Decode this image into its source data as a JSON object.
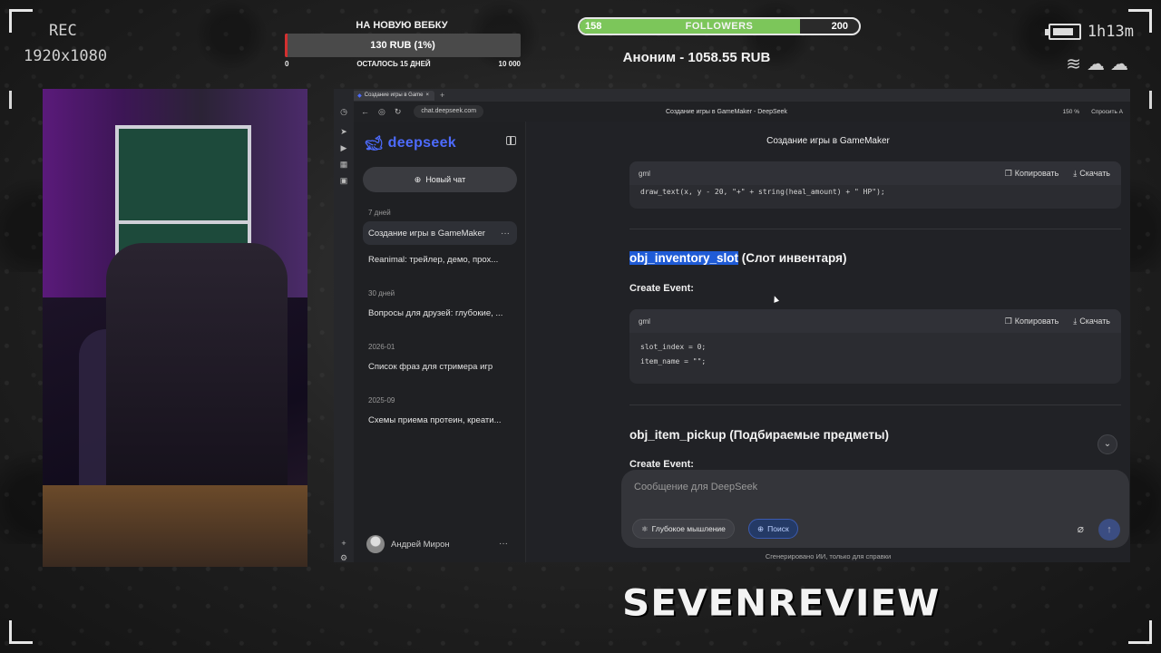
{
  "overlay": {
    "rec": "REC",
    "resolution": "1920x1080",
    "timer": "1h13m",
    "goal": {
      "title": "НА НОВУЮ ВЕБКУ",
      "amount": "130 RUB (1%)",
      "progress_fraction": 0.013,
      "min": "0",
      "remaining": "ОСТАЛОСЬ 15 ДНЕЙ",
      "max": "10 000"
    },
    "followers": {
      "current": "158",
      "label": "FOLLOWERS",
      "target": "200",
      "progress_fraction": 0.79
    },
    "donor": "Аноним - 1058.55 RUB",
    "brand": "SEVENREVIEW"
  },
  "browser": {
    "tab_title": "Создание игры в Game",
    "url": "chat.deepseek.com",
    "page_title": "Создание игры в GameMaker - DeepSeek",
    "zoom": "150 %",
    "ask": "Спросить А"
  },
  "sidebar": {
    "logo": "deepseek",
    "new_chat": "Новый чат",
    "groups": [
      {
        "label": "7 дней",
        "items": [
          "Создание игры в GameMaker",
          "Reanimal: трейлер, демо, прох..."
        ]
      },
      {
        "label": "30 дней",
        "items": [
          "Вопросы для друзей: глубокие, ..."
        ]
      },
      {
        "label": "2026-01",
        "items": [
          "Список фраз для стримера игр"
        ]
      },
      {
        "label": "2025-09",
        "items": [
          "Схемы приема протеин, креати..."
        ]
      }
    ],
    "user": "Андрей Мирон"
  },
  "chat": {
    "title": "Создание игры в GameMaker",
    "code1": {
      "lang": "gml",
      "copy": "Копировать",
      "download": "Скачать",
      "code": "draw_text(x, y - 20, \"+\" + string(heal_amount) + \" HP\");"
    },
    "heading1_code": "obj_inventory_slot",
    "heading1_rest": " (Слот инвентаря)",
    "create_event": "Create Event:",
    "code2": {
      "lang": "gml",
      "copy": "Копировать",
      "download": "Скачать",
      "code": "slot_index = 0;\nitem_name = \"\";"
    },
    "heading2": "obj_item_pickup (Подбираемые предметы)",
    "create_event2": "Create Event:",
    "composer_placeholder": "Сообщение для DeepSeek",
    "deep_think": "Глубокое мышление",
    "search": "Поиск",
    "disclaimer": "Сгенерировано ИИ, только для справки"
  },
  "colors": {
    "accent": "#4d6bfe",
    "goal_fill": "#d33030",
    "followers_fill": "#7cc65a",
    "highlight": "#1f5bd6"
  }
}
